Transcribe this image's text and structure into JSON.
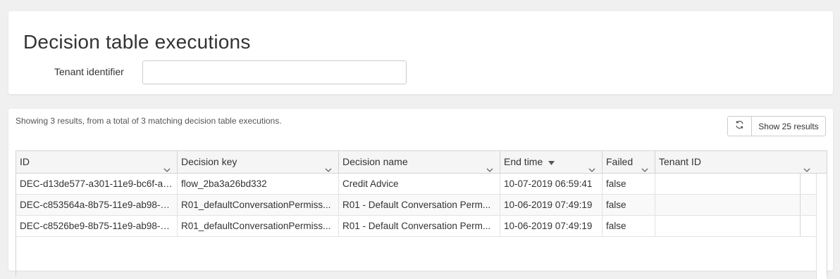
{
  "page": {
    "title": "Decision table executions"
  },
  "filters": {
    "tenant_label": "Tenant identifier",
    "tenant_value": "",
    "tenant_placeholder": ""
  },
  "results": {
    "summary": "Showing 3 results, from a total of 3 matching decision table executions.",
    "page_size_label": "Show 25 results"
  },
  "table": {
    "columns": [
      {
        "label": "ID"
      },
      {
        "label": "Decision key"
      },
      {
        "label": "Decision name"
      },
      {
        "label": "End time",
        "sorted": "desc"
      },
      {
        "label": "Failed"
      },
      {
        "label": "Tenant ID"
      }
    ],
    "rows": [
      [
        "DEC-d13de577-a301-11e9-bc6f-ac...",
        "flow_2ba3a26bd332",
        "Credit Advice",
        "10-07-2019 06:59:41",
        "false",
        ""
      ],
      [
        "DEC-c853564a-8b75-11e9-ab98-a...",
        "R01_defaultConversationPermiss...",
        "R01 - Default Conversation Perm...",
        "10-06-2019 07:49:19",
        "false",
        ""
      ],
      [
        "DEC-c8526be9-8b75-11e9-ab98-a...",
        "R01_defaultConversationPermiss...",
        "R01 - Default Conversation Perm...",
        "10-06-2019 07:49:19",
        "false",
        ""
      ]
    ]
  },
  "icons": {
    "refresh": "refresh-icon",
    "column_menu": "chevron-down-icon",
    "sort": "sort-desc-icon"
  }
}
